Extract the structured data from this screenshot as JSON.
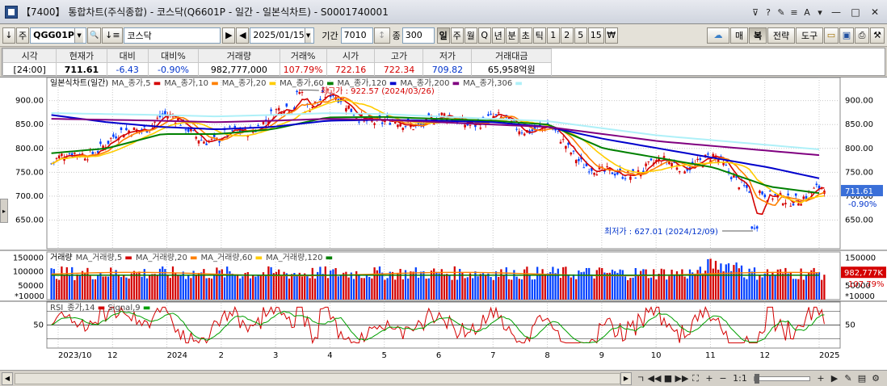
{
  "window": {
    "title": "【7400】 통합차트(주식종합) - 코스닥(Q6601P - 일간 - 일본식차트) - S0001740001",
    "icons": [
      "pin-icon",
      "help-icon",
      "pen-icon",
      "list-icon",
      "font-icon",
      "settings-icon"
    ],
    "minimize": "—",
    "maximize": "□",
    "close": "✕"
  },
  "toolbar": {
    "mode_btn": "↓",
    "type_btn": "주",
    "code": "QGG01P",
    "search_glyph": "🔍",
    "sort_glyph": "↓≡",
    "name": "코스닥",
    "nav_next": "▶",
    "nav_prev": "◀",
    "date": "2025/01/15",
    "period_label": "기간",
    "period_value": "7010",
    "view_label": "↕",
    "count_label": "종",
    "count_value": "300",
    "timeframes": [
      "일",
      "주",
      "월",
      "Q",
      "년",
      "분",
      "초",
      "틱",
      "1",
      "2",
      "5",
      "15",
      "₩"
    ],
    "timeframe_active": "일",
    "right_buttons": [
      "☁",
      "매",
      "복",
      "전략",
      "도구"
    ],
    "right_icons": [
      "folder-icon",
      "save-icon",
      "print-icon",
      "wrench-icon"
    ]
  },
  "quote": {
    "headers": [
      "시각",
      "현재가",
      "대비",
      "대비%",
      "거래량",
      "거래%",
      "시가",
      "고가",
      "저가",
      "거래대금"
    ],
    "values": [
      "[24:00]",
      "711.61",
      "-6.43",
      "-0.90%",
      "982,777,000",
      "107.79%",
      "722.16",
      "722.34",
      "709.82",
      "65,958억원"
    ]
  },
  "price_panel": {
    "legend": "일본식차트(일간)",
    "ma": [
      {
        "label": "MA_종가,5",
        "color": "#d40000"
      },
      {
        "label": "MA_종가,10",
        "color": "#ff8000"
      },
      {
        "label": "MA_종가,20",
        "color": "#ffcc00"
      },
      {
        "label": "MA_종가,60",
        "color": "#008000"
      },
      {
        "label": "MA_종가,120",
        "color": "#0000cc"
      },
      {
        "label": "MA_종가,200",
        "color": "#800080"
      },
      {
        "label": "MA_종가,306",
        "color": "#aef0f8"
      }
    ],
    "y_ticks": [
      "900.00",
      "850.00",
      "800.00",
      "750.00",
      "700.00",
      "650.00"
    ],
    "high_annot": "최고가 : 922.57 (2024/03/26)",
    "low_annot": "최저가 : 627.01 (2024/12/09)",
    "price_tag": "711.61",
    "pct_tag": "-0.90%"
  },
  "volume_panel": {
    "legend": "거래량",
    "ma": [
      {
        "label": "MA_거래량,5",
        "color": "#d40000"
      },
      {
        "label": "MA_거래량,20",
        "color": "#ff8000"
      },
      {
        "label": "MA_거래량,60",
        "color": "#ffcc00"
      },
      {
        "label": "MA_거래량,120",
        "color": "#008000"
      }
    ],
    "y_ticks": [
      "150000",
      "100000",
      "50000"
    ],
    "unit": "*10000",
    "vol_tag": "982,777K",
    "pct_tag": "107.79%"
  },
  "rsi_panel": {
    "legend": "RSI_종가,14",
    "signal": "Signal,9",
    "y_ticks": [
      "50"
    ]
  },
  "x_axis": [
    "2023/10",
    "12",
    "2024",
    "2",
    "3",
    "4",
    "5",
    "6",
    "7",
    "8",
    "9",
    "10",
    "11",
    "12",
    "2025"
  ],
  "chart_data": {
    "type": "line",
    "title": "",
    "xlabel": "",
    "ylabel": "",
    "ylim": [
      600,
      935
    ],
    "x": [
      "2023/10",
      "12",
      "2024",
      "2",
      "3",
      "4",
      "5",
      "6",
      "7",
      "8",
      "9",
      "10",
      "11",
      "12",
      "2025"
    ],
    "series": [
      {
        "name": "종가",
        "values": [
          768,
          810,
          868,
          812,
          868,
          910,
          848,
          860,
          858,
          838,
          740,
          765,
          775,
          690,
          711.61
        ]
      },
      {
        "name": "MA_종가,200",
        "values": [
          862,
          860,
          858,
          855,
          858,
          862,
          860,
          855,
          850,
          845,
          830,
          815,
          805,
          795,
          785
        ]
      },
      {
        "name": "MA_종가,120",
        "values": [
          870,
          855,
          845,
          840,
          845,
          858,
          860,
          858,
          855,
          845,
          820,
          800,
          780,
          760,
          735
        ]
      },
      {
        "name": "MA_종가,60",
        "values": [
          790,
          800,
          830,
          830,
          840,
          865,
          866,
          862,
          858,
          850,
          800,
          780,
          760,
          720,
          705
        ]
      }
    ],
    "volume_ylim": [
      0,
      160000
    ],
    "rsi_ylim": [
      20,
      80
    ],
    "annotations": [
      {
        "text": "최고가 : 922.57 (2024/03/26)",
        "value": 922.57
      },
      {
        "text": "최저가 : 627.01 (2024/12/09)",
        "value": 627.01
      }
    ]
  }
}
